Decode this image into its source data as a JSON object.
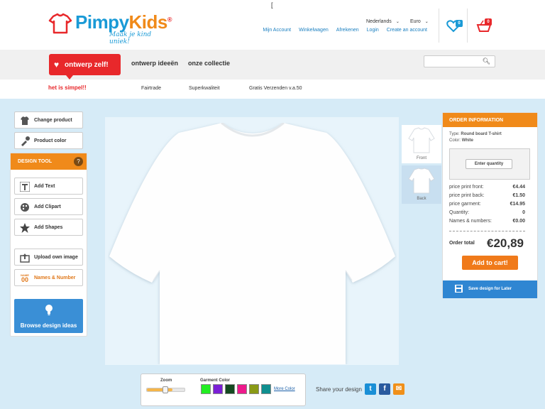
{
  "brand": {
    "word_part1": "Pimpy",
    "word_part2": "Kids",
    "registered": "®",
    "tagline": "Maak je kind uniek!",
    "colors": {
      "blue": "#1a9ad6",
      "orange": "#f08a1a",
      "red": "#e8282b"
    }
  },
  "header": {
    "cursor_mark": "[",
    "language_select": "Nederlands",
    "currency_select": "Euro",
    "links": [
      "Mijn Account",
      "Winkelwagen",
      "Afrekenen",
      "Login",
      "Create an account"
    ],
    "wishlist_count": "0",
    "cart_count": "0",
    "wishlist_icon": "heart-icon",
    "cart_icon": "basket-icon"
  },
  "nav": {
    "design_self_label": "ontwerp zelf!",
    "links": [
      "ontwerp ideeën",
      "onze collectie"
    ],
    "search_placeholder": "",
    "search_icon": "search-icon"
  },
  "subbar": {
    "slogan": "het is simpel!!",
    "items": [
      "Fairtrade",
      "Superkwaliteit",
      "Gratis Verzenden v.a.50"
    ]
  },
  "left_panel": {
    "change_product": "Change product",
    "product_color": "Product color",
    "design_tool_title": "DESIGN TOOL",
    "help_mark": "?",
    "tools": [
      "Add Text",
      "Add Clipart",
      "Add Shapes"
    ],
    "upload_image": "Upload own image",
    "names_number": "Names & Number",
    "names_icon_text": "NAME",
    "names_icon_digits": "00",
    "browse_ideas": "Browse design ideas"
  },
  "views": {
    "front": "Front",
    "back": "Back",
    "selected": "Front"
  },
  "order": {
    "title": "ORDER INFORMATION",
    "type_label": "Type:",
    "type_value": "Round board T-shirt",
    "color_label": "Color:",
    "color_value": "White",
    "enter_quantity": "Enter quantity",
    "rows": [
      {
        "label": "price print front:",
        "value": "€4.44"
      },
      {
        "label": "price print back:",
        "value": "€1.50"
      },
      {
        "label": "price garment:",
        "value": "€14.95"
      },
      {
        "label": "Quantity:",
        "value": "0"
      },
      {
        "label": "Names & numbers:",
        "value": "€0.00"
      }
    ],
    "total_label": "Order total",
    "total_value": "€20,89",
    "add_to_cart": "Add to cart!",
    "save_later": "Save design for Later"
  },
  "bottom": {
    "zoom_label": "Zoom",
    "zoom_level": 0.68,
    "garment_color_label": "Garment Color",
    "swatches": [
      "#22ee22",
      "#7b1fd6",
      "#144a20",
      "#ee1a8c",
      "#8a9a16",
      "#0f8f8f"
    ],
    "more_color": "More Color",
    "share_label": "Share your design",
    "social": [
      "twitter-icon",
      "facebook-icon",
      "email-icon"
    ]
  }
}
